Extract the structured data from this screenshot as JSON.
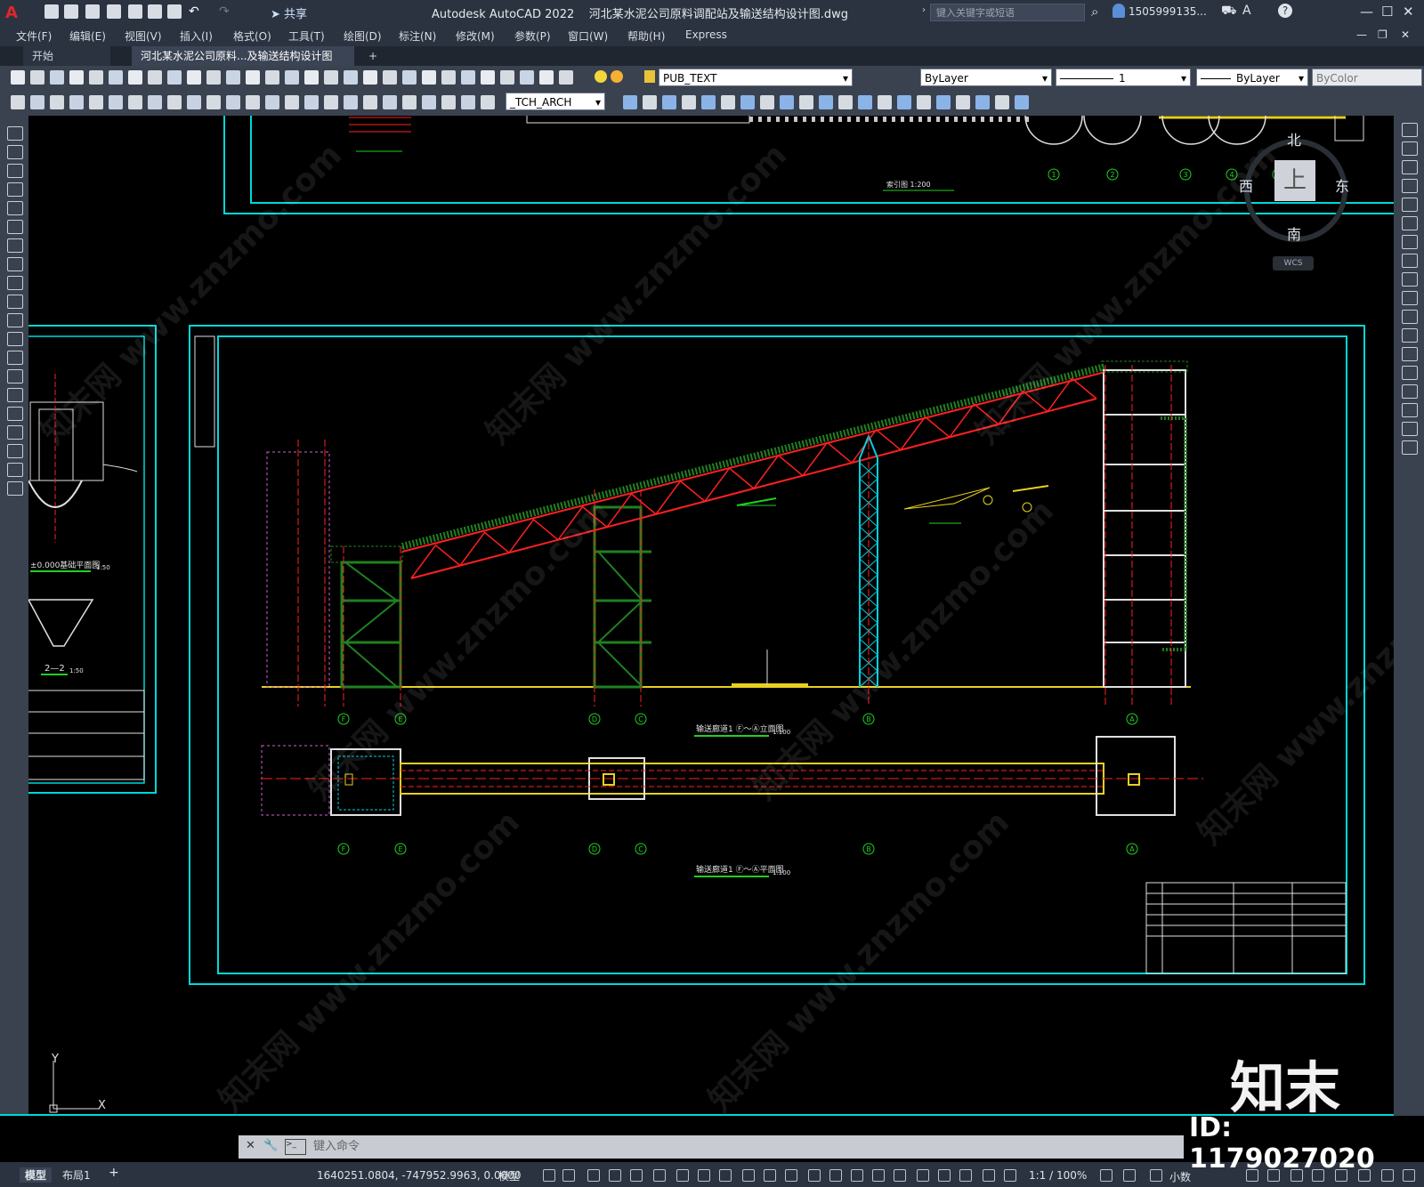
{
  "title_bar": {
    "app_title": "Autodesk AutoCAD 2022",
    "file_title": "河北某水泥公司原料调配站及输送结构设计图.dwg",
    "share_label": "共享",
    "search_placeholder": "键入关键字或短语",
    "user": "1505999135..."
  },
  "menu": [
    "文件(F)",
    "编辑(E)",
    "视图(V)",
    "插入(I)",
    "格式(O)",
    "工具(T)",
    "绘图(D)",
    "标注(N)",
    "修改(M)",
    "参数(P)",
    "窗口(W)",
    "帮助(H)",
    "Express"
  ],
  "tabs": {
    "start": "开始",
    "doc": "河北某水泥公司原料...及输送结构设计图*",
    "add": "+"
  },
  "toolbar": {
    "layer_value": "PUB_TEXT",
    "color_value": "ByLayer",
    "linetype_value": "1",
    "lineweight_value": "ByLayer",
    "plotstyle_value": "ByColor",
    "textstyle_value": "_TCH_ARCH"
  },
  "viewcube": {
    "north": "北",
    "south": "南",
    "east": "东",
    "west": "西",
    "top": "上",
    "wcs": "WCS"
  },
  "drawing": {
    "elevation_title": "输送廊道1 Ⓕ～Ⓐ立面图",
    "plan_title": "输送廊道1 Ⓕ～Ⓐ平面图",
    "scale_100": "1:100",
    "section_title": "索引图 1:200",
    "left_title_1": "±0.000基础平面图",
    "left_title_2": "2—2",
    "scale_50": "1:50",
    "axes_elev": [
      "F",
      "E",
      "D",
      "C",
      "B",
      "A"
    ],
    "axis_numbers": [
      "1",
      "2",
      "3",
      "4",
      "5"
    ]
  },
  "command": {
    "placeholder": "键入命令"
  },
  "status": {
    "model_tab": "模型",
    "layout_tab": "布局1",
    "coords": "1640251.0804, -747952.9963, 0.0000",
    "model_label": "模型",
    "scale": "1:1 / 100%",
    "units": "小数"
  },
  "overlay": {
    "brand": "知末",
    "id": "ID: 1179027020"
  }
}
